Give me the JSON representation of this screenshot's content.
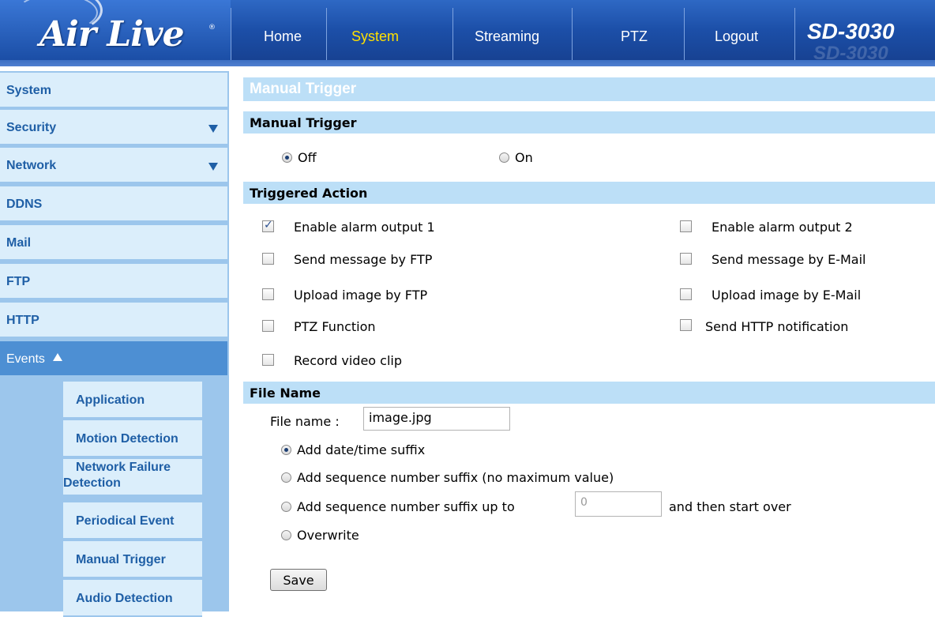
{
  "header": {
    "brand": "Air Live",
    "reg_mark": "®",
    "model": "SD-3030",
    "nav": [
      {
        "label": "Home"
      },
      {
        "label": "System"
      },
      {
        "label": "Streaming"
      },
      {
        "label": "PTZ"
      },
      {
        "label": "Logout"
      }
    ],
    "active_nav": "System"
  },
  "sidebar": {
    "items": [
      {
        "label": "System"
      },
      {
        "label": "Security"
      },
      {
        "label": "Network"
      },
      {
        "label": "DDNS"
      },
      {
        "label": "Mail"
      },
      {
        "label": "FTP"
      },
      {
        "label": "HTTP"
      },
      {
        "label": "Events"
      }
    ],
    "sub_items": [
      {
        "label": "Application"
      },
      {
        "label": "Motion Detection"
      },
      {
        "label_line1": "Network Failure",
        "label_line2": "Detection"
      },
      {
        "label": "Periodical Event"
      },
      {
        "label": "Manual Trigger"
      },
      {
        "label": "Audio Detection"
      }
    ]
  },
  "main": {
    "page_title": "Manual Trigger",
    "manual_trigger": {
      "heading": "Manual Trigger",
      "off_label": "Off",
      "on_label": "On",
      "selected": "Off"
    },
    "triggered_action": {
      "heading": "Triggered Action",
      "left": [
        {
          "label": "Enable alarm output 1",
          "checked": true
        },
        {
          "label": "Send message by FTP",
          "checked": false
        },
        {
          "label": "Upload image by FTP",
          "checked": false
        },
        {
          "label": "PTZ Function",
          "checked": false
        },
        {
          "label": "Record video clip",
          "checked": false
        }
      ],
      "right": [
        {
          "label": "Enable alarm output 2",
          "checked": false
        },
        {
          "label": "Send message by E-Mail",
          "checked": false
        },
        {
          "label": "Upload image by E-Mail",
          "checked": false
        },
        {
          "label": "Send HTTP notification",
          "checked": false
        }
      ]
    },
    "file_name": {
      "heading": "File Name",
      "field_label": "File name :",
      "field_value": "image.jpg",
      "options": [
        {
          "label": "Add date/time suffix",
          "selected": true
        },
        {
          "label": "Add sequence number suffix (no maximum value)",
          "selected": false
        },
        {
          "label": "Add sequence number suffix up to",
          "selected": false
        },
        {
          "label": "Overwrite",
          "selected": false
        }
      ],
      "seq_max_value": "0",
      "seq_after_label": "and then start over"
    },
    "save_label": "Save"
  },
  "colors": {
    "header_blue": "#1c4fa8",
    "active_nav": "#ffe000",
    "sidebar_bg": "#9cc6ec",
    "menu_item_bg": "#dbeefb",
    "menu_text": "#1f5fa6",
    "events_bg": "#4d8fd3",
    "section_bar": "#bcdff7"
  }
}
